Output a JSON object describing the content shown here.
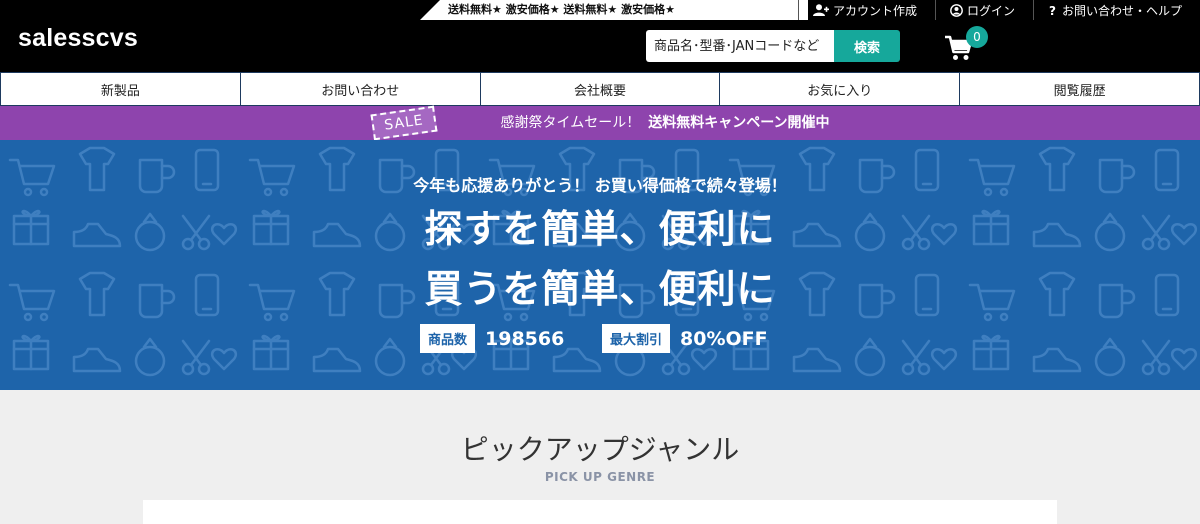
{
  "header": {
    "ticker": "送料無料★ 激安価格★ 送料無料★ 激安価格★",
    "logo": "salesscvs",
    "top_links": [
      {
        "label": "アカウント作成",
        "icon": "user-plus-icon"
      },
      {
        "label": "ログイン",
        "icon": "user-circle-icon"
      },
      {
        "label": "お問い合わせ・ヘルプ",
        "icon": "question-icon"
      }
    ],
    "search": {
      "placeholder": "商品名･型番･JANコードなど",
      "button": "検索"
    },
    "cart": {
      "icon": "cart-icon",
      "count": "0"
    }
  },
  "nav": {
    "items": [
      "新製品",
      "お問い合わせ",
      "会社概要",
      "お気に入り",
      "閲覧履歴"
    ]
  },
  "sale_banner": {
    "tag": "SALE",
    "text": "感謝祭タイムセール！",
    "highlight": "送料無料キャンペーン開催中"
  },
  "hero": {
    "subtitle": "今年も応援ありがとう！ お買い得価格で続々登場！",
    "line1": "探すを簡単、便利に",
    "line2": "買うを簡単、便利に",
    "stats": [
      {
        "label": "商品数",
        "value": "198566"
      },
      {
        "label": "最大割引",
        "value": "80%OFF"
      }
    ]
  },
  "pickup": {
    "title": "ピックアップジャンル",
    "subtitle": "PICK UP GENRE"
  },
  "colors": {
    "header_bg": "#000000",
    "accent": "#16a89b",
    "sale_bar": "#8e44ad",
    "hero_bg": "#1e64aa",
    "nav_border": "#1e3a5f",
    "page_bg": "#efefef"
  }
}
